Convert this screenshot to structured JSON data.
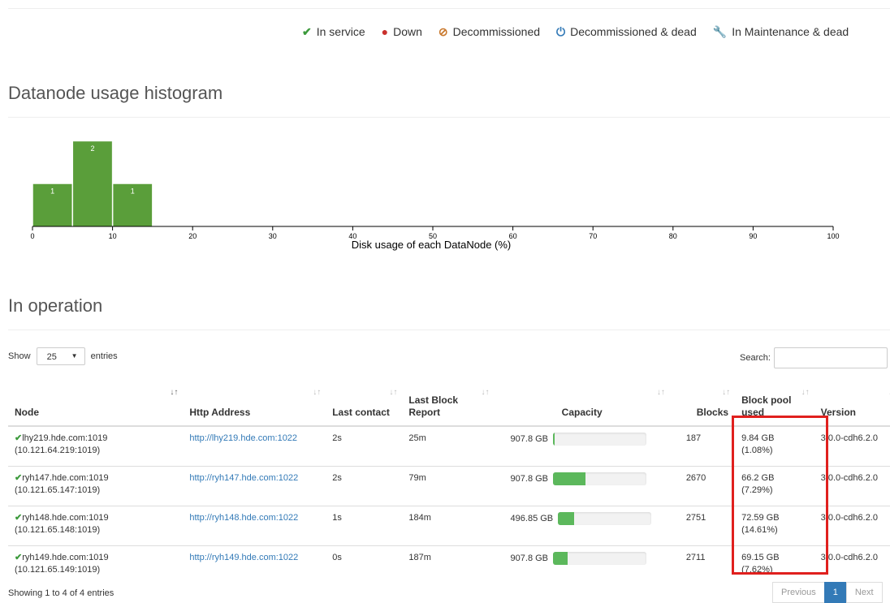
{
  "legend": [
    {
      "icon": "check-icon",
      "glyph": "✔",
      "cls": "ic-ok",
      "label": "In service"
    },
    {
      "icon": "exclamation-circle-icon",
      "glyph": "●",
      "cls": "ic-down",
      "label": "Down"
    },
    {
      "icon": "ban-circle-icon",
      "glyph": "⊘",
      "cls": "ic-dec",
      "label": "Decommissioned"
    },
    {
      "icon": "power-icon",
      "glyph": "⏻",
      "cls": "ic-decdead",
      "label": "Decommissioned & dead"
    },
    {
      "icon": "wrench-icon",
      "glyph": "🔧",
      "cls": "ic-maint",
      "label": "In Maintenance & dead"
    }
  ],
  "histogram": {
    "title": "Datanode usage histogram",
    "chart_data": {
      "type": "bar",
      "bins": [
        [
          0,
          5
        ],
        [
          5,
          10
        ],
        [
          10,
          15
        ]
      ],
      "values": [
        1,
        2,
        1
      ],
      "xlabel": "Disk usage of each DataNode (%)",
      "xticks": [
        "0",
        "10",
        "20",
        "30",
        "40",
        "50",
        "60",
        "70",
        "80",
        "90",
        "100"
      ],
      "xlim": [
        0,
        100
      ],
      "color": "#5a9e3a"
    }
  },
  "operation": {
    "title": "In operation",
    "show_label": "Show",
    "entries_value": "25",
    "entries_label": "entries",
    "search_label": "Search:",
    "columns": [
      "Node",
      "Http Address",
      "Last contact",
      "Last Block Report",
      "Capacity",
      "Blocks",
      "Block pool used",
      "Version"
    ],
    "rows": [
      {
        "node": "lhy219.hde.com:1019",
        "ip": "(10.121.64.219:1019)",
        "http": "http://lhy219.hde.com:1022",
        "contact": "2s",
        "report": "25m",
        "capacity": "907.8 GB",
        "usage": 0.01,
        "blocks": "187",
        "pool": "9.84 GB (1.08%)",
        "version": "3.0.0-cdh6.2.0"
      },
      {
        "node": "ryh147.hde.com:1019",
        "ip": "(10.121.65.147:1019)",
        "http": "http://ryh147.hde.com:1022",
        "contact": "2s",
        "report": "79m",
        "capacity": "907.8 GB",
        "usage": 0.35,
        "blocks": "2670",
        "pool": "66.2 GB (7.29%)",
        "version": "3.0.0-cdh6.2.0"
      },
      {
        "node": "ryh148.hde.com:1019",
        "ip": "(10.121.65.148:1019)",
        "http": "http://ryh148.hde.com:1022",
        "contact": "1s",
        "report": "184m",
        "capacity": "496.85 GB",
        "usage": 0.17,
        "blocks": "2751",
        "pool": "72.59 GB (14.61%)",
        "version": "3.0.0-cdh6.2.0"
      },
      {
        "node": "ryh149.hde.com:1019",
        "ip": "(10.121.65.149:1019)",
        "http": "http://ryh149.hde.com:1022",
        "contact": "0s",
        "report": "187m",
        "capacity": "907.8 GB",
        "usage": 0.16,
        "blocks": "2711",
        "pool": "69.15 GB (7.62%)",
        "version": "3.0.0-cdh6.2.0"
      }
    ],
    "showing": "Showing 1 to 4 of 4 entries",
    "pager": {
      "prev": "Previous",
      "current": "1",
      "next": "Next"
    }
  }
}
